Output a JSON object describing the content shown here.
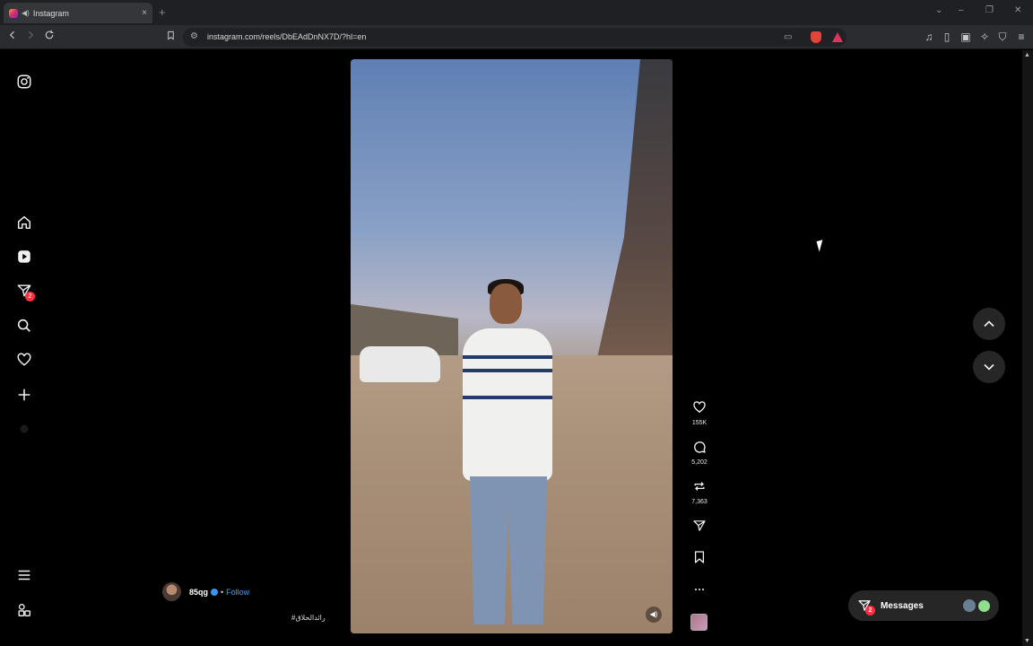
{
  "browser": {
    "tab_title": "Instagram",
    "tab_close": "×",
    "new_tab": "+",
    "url": "instagram.com/reels/DbEAdDnNX7D/?hl=en",
    "window_controls": [
      "⌄",
      "–",
      "❐",
      "✕"
    ]
  },
  "sidebar": {
    "items": [
      {
        "name": "instagram-logo-icon"
      },
      {
        "name": "home-icon"
      },
      {
        "name": "reels-icon"
      },
      {
        "name": "messages-icon",
        "badge": "2"
      },
      {
        "name": "search-icon"
      },
      {
        "name": "notifications-icon"
      },
      {
        "name": "create-icon"
      },
      {
        "name": "profile-icon"
      },
      {
        "name": "more-menu-icon"
      },
      {
        "name": "also-from-meta-icon"
      }
    ]
  },
  "reel": {
    "author": {
      "username": "85qg",
      "separator": "•",
      "follow_label": "Follow"
    },
    "caption": "#رائدالحلاق",
    "actions": {
      "likes": "155K",
      "comments": "5,202",
      "reposts": "7,363"
    }
  },
  "messages": {
    "label": "Messages",
    "badge": "2"
  },
  "colors": {
    "accent_blue": "#4a9cf5",
    "badge_red": "#ff3040",
    "page_bg": "#000000"
  }
}
